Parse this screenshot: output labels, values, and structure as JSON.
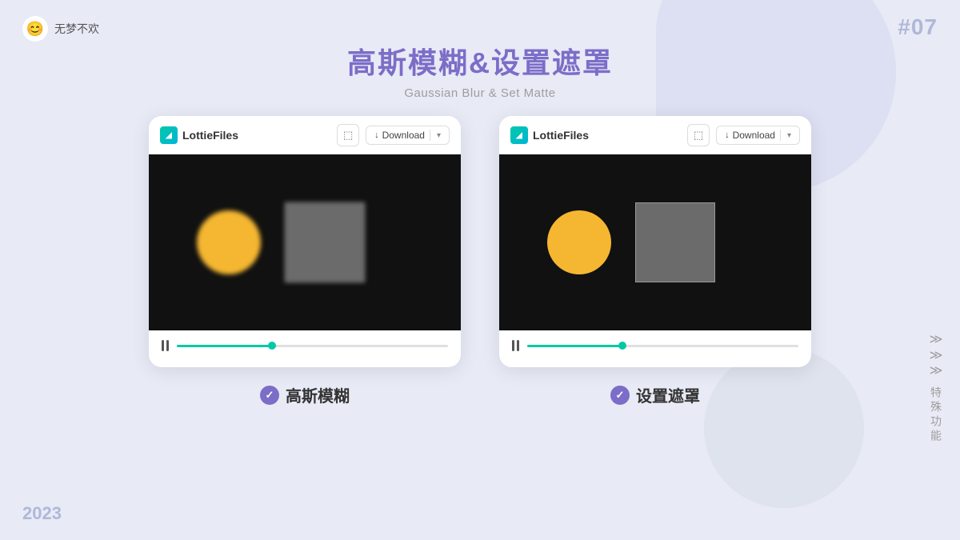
{
  "user": {
    "avatar": "😊",
    "name": "无梦不欢"
  },
  "slide": {
    "number": "#07",
    "main_title": "高斯模糊&设置遮罩",
    "sub_title": "Gaussian Blur & Set Matte",
    "year": "2023"
  },
  "cards": [
    {
      "id": "left",
      "logo_text": "LottieFiles",
      "download_label": "Download",
      "progress_percent": 35,
      "has_blur": true,
      "label": "高斯模糊"
    },
    {
      "id": "right",
      "logo_text": "LottieFiles",
      "download_label": "Download",
      "progress_percent": 35,
      "has_blur": false,
      "label": "设置遮罩"
    }
  ],
  "sidebar": {
    "arrows": "≫\n≫\n≫",
    "label": "特殊功能"
  },
  "icons": {
    "check": "✓",
    "folder": "📁",
    "download_arrow": "↓",
    "lottie_letter": "L"
  }
}
